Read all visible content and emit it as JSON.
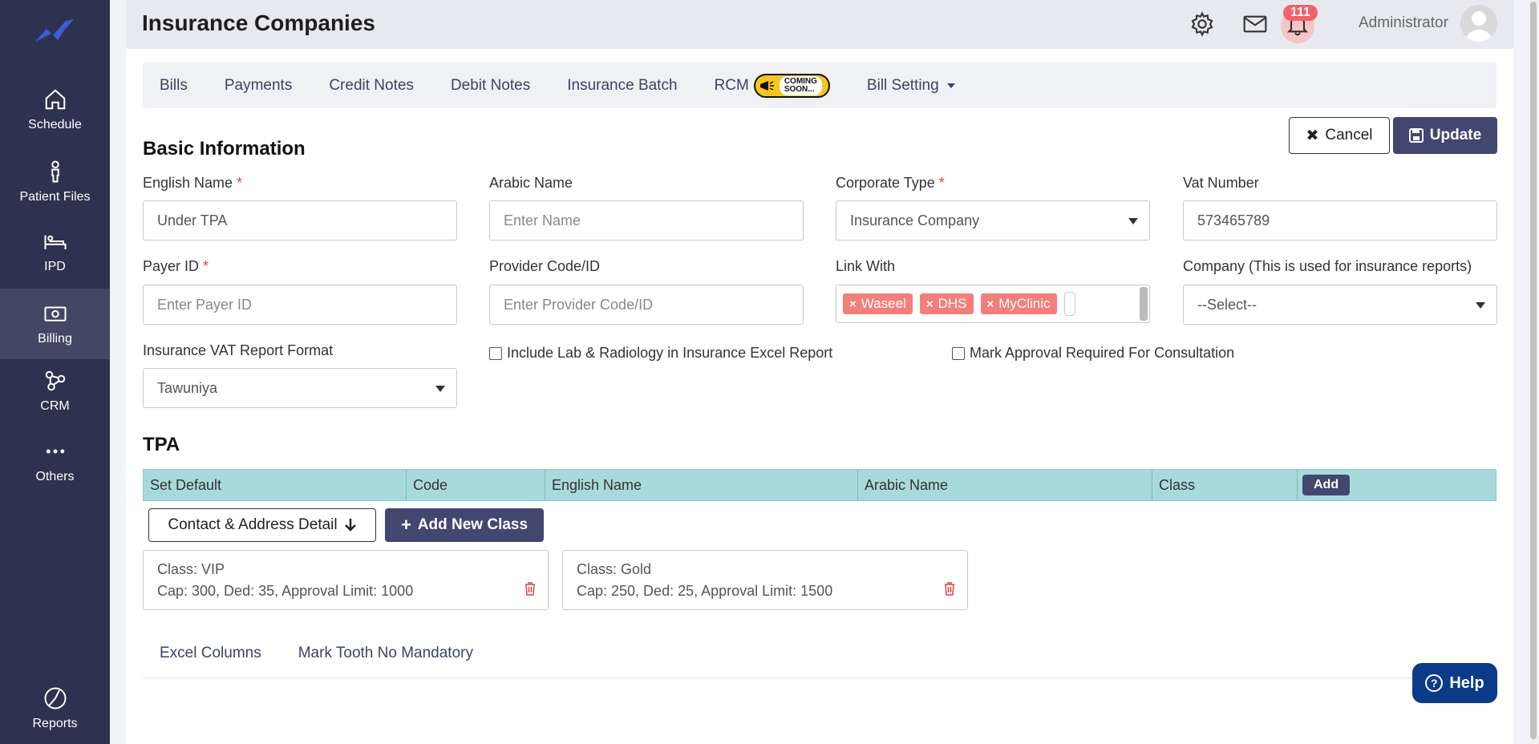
{
  "sidebar": {
    "items": [
      {
        "label": "Schedule",
        "icon": "home-icon"
      },
      {
        "label": "Patient Files",
        "icon": "person-icon"
      },
      {
        "label": "IPD",
        "icon": "bed-icon"
      },
      {
        "label": "Billing",
        "icon": "money-icon"
      },
      {
        "label": "CRM",
        "icon": "network-icon"
      },
      {
        "label": "Others",
        "icon": "dots-icon"
      },
      {
        "label": "Reports",
        "icon": "pie-icon"
      }
    ],
    "active": "Billing"
  },
  "header": {
    "title": "Insurance Companies",
    "notification_count": "111",
    "user_name": "Administrator"
  },
  "tabs": {
    "bills": "Bills",
    "payments": "Payments",
    "credit_notes": "Credit Notes",
    "debit_notes": "Debit Notes",
    "insurance_batch": "Insurance Batch",
    "rcm": "RCM",
    "coming_soon_1": "COMING",
    "coming_soon_2": "SOON...",
    "bill_setting": "Bill Setting"
  },
  "actions": {
    "cancel": "Cancel",
    "update": "Update"
  },
  "basic_info": {
    "title": "Basic Information",
    "english_name_label": "English Name",
    "english_name_value": "Under TPA",
    "arabic_name_label": "Arabic Name",
    "arabic_name_placeholder": "Enter Name",
    "corporate_type_label": "Corporate Type",
    "corporate_type_value": "Insurance Company",
    "vat_label": "Vat Number",
    "vat_value": "573465789",
    "payer_id_label": "Payer ID",
    "payer_id_placeholder": "Enter Payer ID",
    "provider_code_label": "Provider Code/ID",
    "provider_code_placeholder": "Enter Provider Code/ID",
    "link_with_label": "Link With",
    "link_with_tags": [
      "Waseel",
      "DHS",
      "MyClinic"
    ],
    "company_label": "Company (This is used for insurance reports)",
    "company_value": "--Select--",
    "vat_report_label": "Insurance VAT Report Format",
    "vat_report_value": "Tawuniya",
    "include_lab_label": "Include Lab & Radiology in Insurance Excel Report",
    "mark_approval_label": "Mark Approval Required For Consultation",
    "required_mark": "*"
  },
  "tpa": {
    "title": "TPA",
    "columns": [
      "Set Default",
      "Code",
      "English Name",
      "Arabic Name",
      "Class"
    ],
    "add_label": "Add"
  },
  "class_actions": {
    "contact_detail": "Contact & Address Detail",
    "add_new_class": "Add New Class"
  },
  "classes": [
    {
      "name": "Class: VIP",
      "details": "Cap: 300, Ded: 35, Approval Limit: 1000"
    },
    {
      "name": "Class: Gold",
      "details": "Cap: 250, Ded: 25, Approval Limit: 1500"
    }
  ],
  "bottom_tabs": {
    "excel_columns": "Excel Columns",
    "mark_tooth": "Mark Tooth No Mandatory"
  },
  "help": {
    "label": "Help"
  }
}
